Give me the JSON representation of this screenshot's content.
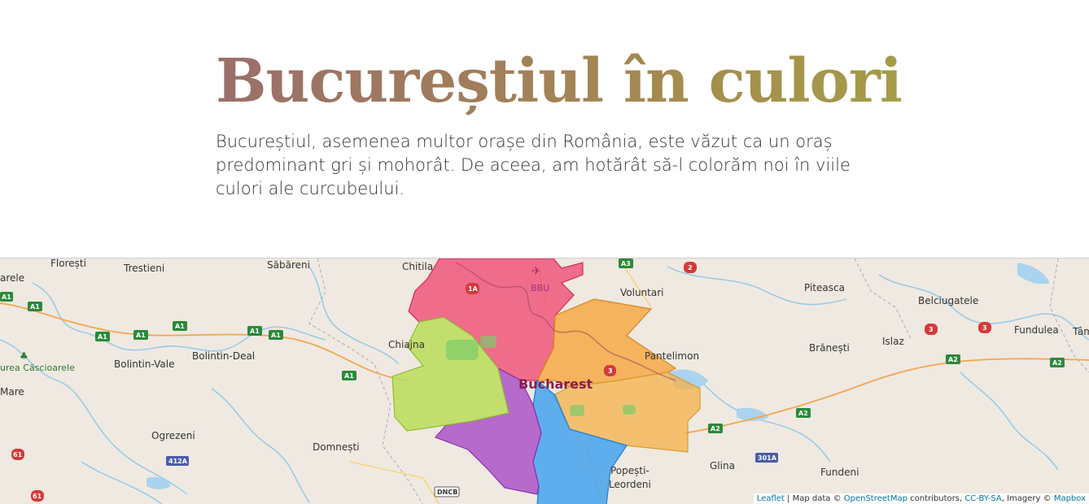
{
  "header": {
    "title": "Bucureștiul în culori",
    "intro": "Bucureștiul, asemenea multor orașe din România, este văzut ca un oraș predominant gri și mohorât. De aceea, am hotărât să-l colorăm noi în viile culori ale curcubeului."
  },
  "map": {
    "city_label": "Bucharest",
    "airport_label": "BBU",
    "places": {
      "floresti": "Florești",
      "trestieni": "Trestieni",
      "sabareni": "Săbăreni",
      "chitila": "Chitila",
      "voluntari": "Voluntari",
      "piteasca": "Piteasca",
      "belciugatele": "Belciugatele",
      "fundulea": "Fundulea",
      "tam": "Tâm",
      "arele": "arele",
      "chiajna": "Chiajna",
      "bolintin_vale": "Bolintin-Vale",
      "bolintin_deal": "Bolintin-Deal",
      "pantelimon": "Pantelimon",
      "branesti": "Brănești",
      "islaz": "Islaz",
      "mare": "Mare",
      "ogrezeni": "Ogrezeni",
      "domnesti": "Domnești",
      "popesti": "Popești-",
      "leordeni": "Leordeni",
      "glina": "Glina",
      "fundeni": "Fundeni"
    },
    "forest_label": "urea Căscioarele",
    "roads": {
      "a1": "A1",
      "a2": "A2",
      "a3": "A3",
      "r1a": "1A",
      "r2": "2",
      "r3": "3",
      "r61": "61",
      "r412a": "412A",
      "r301a": "301A",
      "dncb": "DNCB"
    },
    "sector_colors": {
      "pink": "#f0426e",
      "orange": "#f7a030",
      "yellow": "#f5b24a",
      "green": "#b6dc50",
      "purple": "#a64ac7",
      "blue": "#3a9ff0"
    },
    "attribution": {
      "leaflet": "Leaflet",
      "sep": " | Map data © ",
      "osm": "OpenStreetMap",
      "contributors": " contributors, ",
      "license": "CC-BY-SA",
      "imagery": ", Imagery © ",
      "mapbox": "Mapbox"
    }
  }
}
